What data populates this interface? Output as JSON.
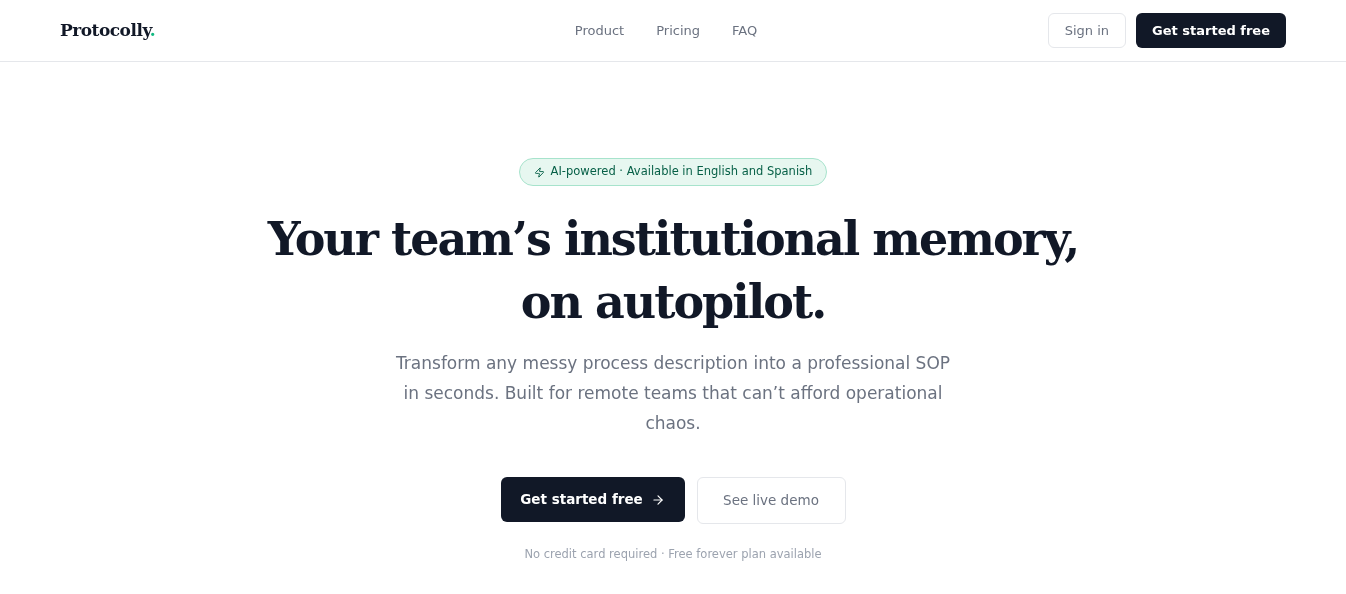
{
  "header": {
    "logo": {
      "name": "Protocolly",
      "mark": "."
    },
    "nav": [
      "Product",
      "Pricing",
      "FAQ"
    ],
    "sign_in": "Sign in",
    "cta": "Get started free"
  },
  "hero": {
    "badge": "AI-powered · Available in English and Spanish",
    "headline": [
      "Your team’s institutional memory,",
      "on autopilot."
    ],
    "subtitle": "Transform any messy process description into a professional SOP in seconds. Built for remote teams that can’t afford operational chaos.",
    "primary_button": "Get started free",
    "secondary_button": "See live demo",
    "note": "No credit card required · Free forever plan available"
  }
}
